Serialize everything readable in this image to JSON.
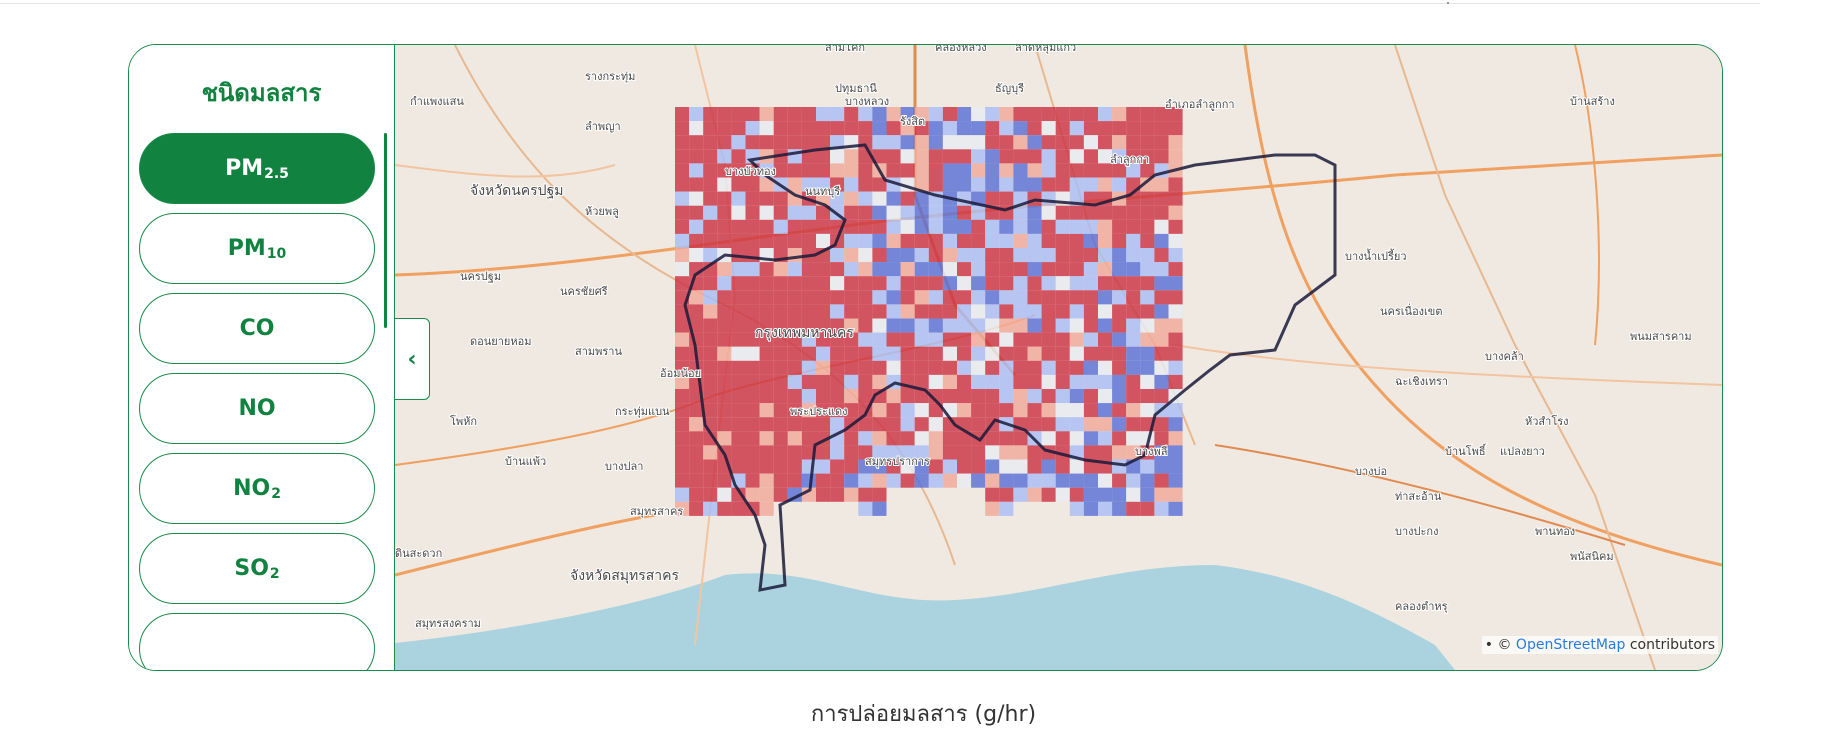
{
  "panel": {
    "title": "ชนิดมลสาร",
    "pollutants": [
      {
        "name": "PM",
        "sub": "2.5",
        "active": true
      },
      {
        "name": "PM",
        "sub": "10",
        "active": false
      },
      {
        "name": "CO",
        "sub": "",
        "active": false
      },
      {
        "name": "NO",
        "sub": "",
        "active": false
      },
      {
        "name": "NO",
        "sub": "2",
        "active": false
      },
      {
        "name": "SO",
        "sub": "2",
        "active": false
      }
    ]
  },
  "map": {
    "attribution_prefix": "©",
    "attribution_link": "OpenStreetMap",
    "attribution_suffix": "contributors",
    "colors": {
      "high": "#cc3344",
      "mid_high": "#f2a99a",
      "low": "#5a6fd6",
      "mid_low": "#a9bdf5",
      "neutral": "#e8ecf2"
    },
    "labels": [
      {
        "text": "สามโคก"
      },
      {
        "text": "คลองหลวง"
      },
      {
        "text": "ลาดหลุมแก้ว"
      },
      {
        "text": "ปทุมธานี"
      },
      {
        "text": "ธัญบุรี"
      },
      {
        "text": "กำแพงแสน"
      },
      {
        "text": "บางบัวทอง"
      },
      {
        "text": "นนทบุรี"
      },
      {
        "text": "รังสิต"
      },
      {
        "text": "จังหวัดนครปฐม"
      },
      {
        "text": "นครปฐม"
      },
      {
        "text": "ห้วยพลู"
      },
      {
        "text": "นครชัยศรี"
      },
      {
        "text": "อำเภอลำลูกกา"
      },
      {
        "text": "ลำลูกกา"
      },
      {
        "text": "บ้านสร้าง"
      },
      {
        "text": "บางน้ำเปรี้ยว"
      },
      {
        "text": "กรุงเทพมหานคร"
      },
      {
        "text": "สามพราน"
      },
      {
        "text": "อ้อมน้อย"
      },
      {
        "text": "กระทุ่มแบน"
      },
      {
        "text": "พระประแดง"
      },
      {
        "text": "บางพลี"
      },
      {
        "text": "สมุทรปราการ"
      },
      {
        "text": "บางบ่อ"
      },
      {
        "text": "สมุทรสาคร"
      },
      {
        "text": "จังหวัดสมุทรสาคร"
      },
      {
        "text": "บ้านแพ้ว"
      },
      {
        "text": "บางปลา"
      },
      {
        "text": "โพหัก"
      },
      {
        "text": "ดอนยายหอม"
      },
      {
        "text": "นครเนื่องเขต"
      },
      {
        "text": "ฉะเชิงเทรา"
      },
      {
        "text": "บางคล้า"
      },
      {
        "text": "พนมสารคาม"
      },
      {
        "text": "บ้านโพธิ์"
      },
      {
        "text": "แปลงยาว"
      },
      {
        "text": "หัวสำโรง"
      },
      {
        "text": "ท่าสะอ้าน"
      },
      {
        "text": "บางปะกง"
      },
      {
        "text": "พานทอง"
      },
      {
        "text": "พนัสนิคม"
      },
      {
        "text": "คลองตำหรุ"
      },
      {
        "text": "สมุทรสงคราม"
      },
      {
        "text": "ลำพญา"
      },
      {
        "text": "รางกระทุ่ม"
      },
      {
        "text": "บางหลวง"
      },
      {
        "text": "ดินสะดวก"
      }
    ]
  },
  "caption": "การปล่อยมลสาร (g/hr)"
}
